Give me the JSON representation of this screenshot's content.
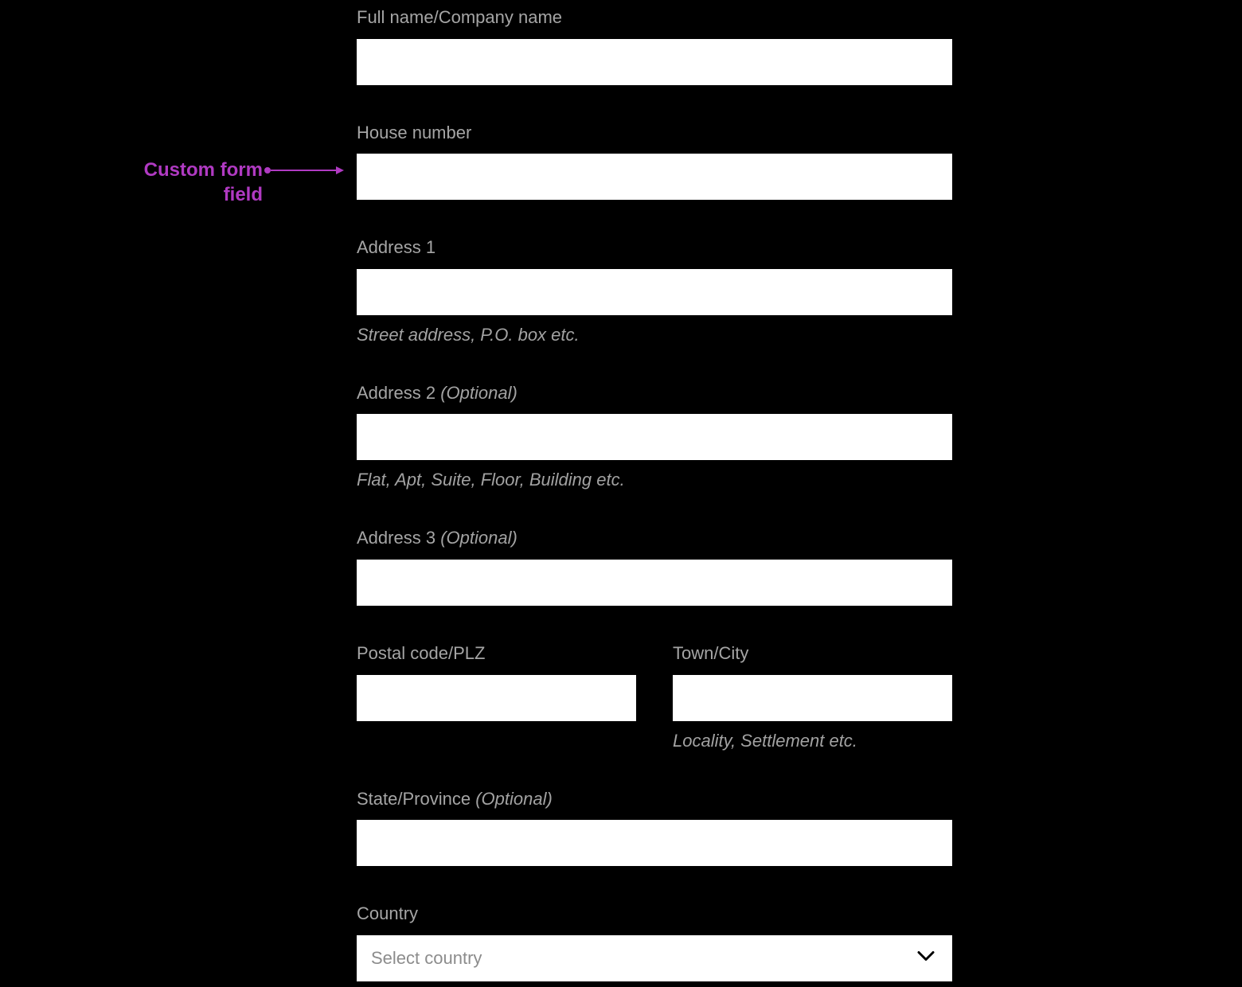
{
  "annotation": {
    "line1": "Custom form",
    "line2": "field"
  },
  "form": {
    "full_name": {
      "label": "Full name/Company name",
      "value": ""
    },
    "house_number": {
      "label": "House number",
      "value": ""
    },
    "address1": {
      "label": "Address 1",
      "value": "",
      "helper": "Street address, P.O. box etc."
    },
    "address2": {
      "label": "Address 2",
      "optional": "(Optional)",
      "value": "",
      "helper": "Flat, Apt, Suite, Floor, Building etc."
    },
    "address3": {
      "label": "Address 3",
      "optional": "(Optional)",
      "value": ""
    },
    "postal": {
      "label": "Postal code/PLZ",
      "value": ""
    },
    "city": {
      "label": "Town/City",
      "value": "",
      "helper": "Locality, Settlement etc."
    },
    "state": {
      "label": "State/Province",
      "optional": "(Optional)",
      "value": ""
    },
    "country": {
      "label": "Country",
      "placeholder": "Select country"
    }
  }
}
